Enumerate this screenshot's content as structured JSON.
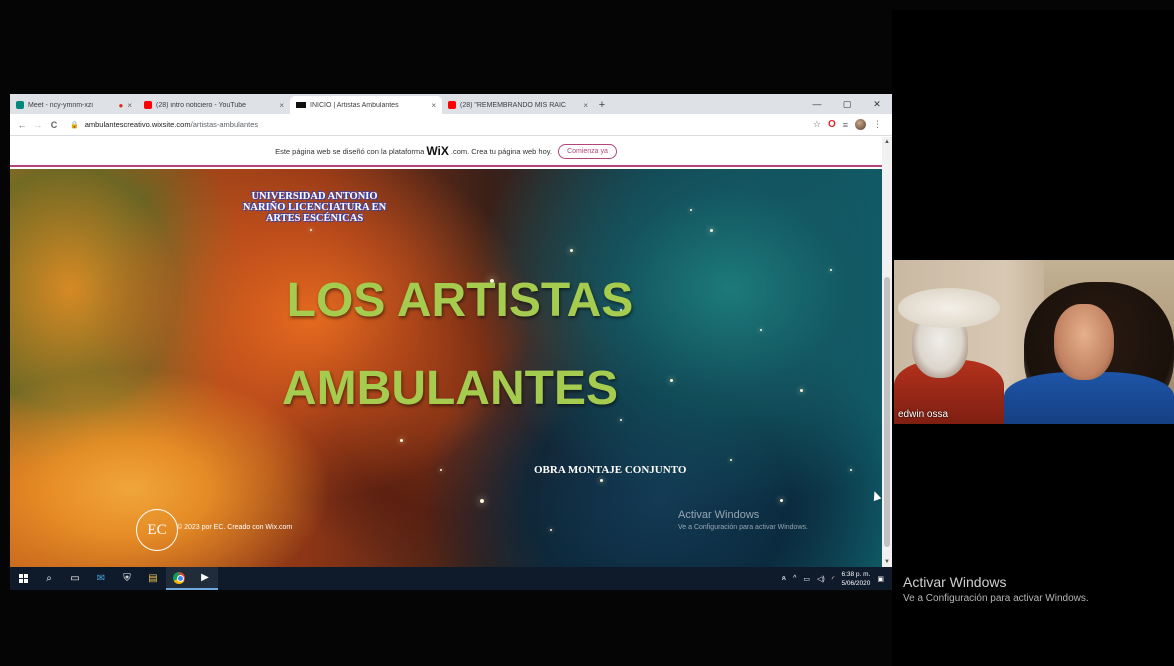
{
  "browser": {
    "tabs": [
      {
        "label": "Meet - ncy-ymnm-xzi",
        "favicon_color": "#00897b",
        "recording": true,
        "active": false
      },
      {
        "label": "(28) intro noticiero - YouTube",
        "favicon_color": "#ff0000",
        "active": false
      },
      {
        "label": "INICIO | Artistas Ambulantes",
        "favicon_color": "#111111",
        "active": true
      },
      {
        "label": "(28) \"REMEMBRANDO MIS RAIC",
        "favicon_color": "#ff0000",
        "active": false
      }
    ],
    "new_tab": "+",
    "close_glyph": "×",
    "window_controls": {
      "minimize": "—",
      "maximize": "▢",
      "close": "✕"
    },
    "nav": {
      "back": "←",
      "forward": "→",
      "reload": "C"
    },
    "url_host": "ambulantescreativo.wixsite.com",
    "url_path": "/artistas-ambulantes"
  },
  "wix_banner": {
    "text_before": "Este página web se diseñó con la plataforma",
    "logo": "WiX",
    "text_after": ".com. Crea tu página web hoy.",
    "cta": "Comienza ya"
  },
  "hero": {
    "university": "UNIVERSIDAD ANTONIO NARIÑO LICENCIATURA EN ARTES ESCÉNICAS",
    "title_line1": "LOS ARTISTAS",
    "title_line2": "AMBULANTES",
    "subtitle": "OBRA MONTAJE CONJUNTO",
    "logo_text": "EC",
    "copyright": "© 2023 por EC. Creado con Wix.com",
    "watermark_title": "Activar Windows",
    "watermark_sub": "Ve a Configuración para activar Windows."
  },
  "taskbar": {
    "clock_time": "6:38 p. m.",
    "clock_date": "5/06/2020"
  },
  "participant": {
    "name": "edwin ossa"
  },
  "outer_watermark": {
    "title": "Activar Windows",
    "sub": "Ve a Configuración para activar Windows."
  },
  "colors": {
    "title_green": "#a6cc4f",
    "wix_accent": "#b3457c",
    "taskbar": "#0f1b2b"
  }
}
